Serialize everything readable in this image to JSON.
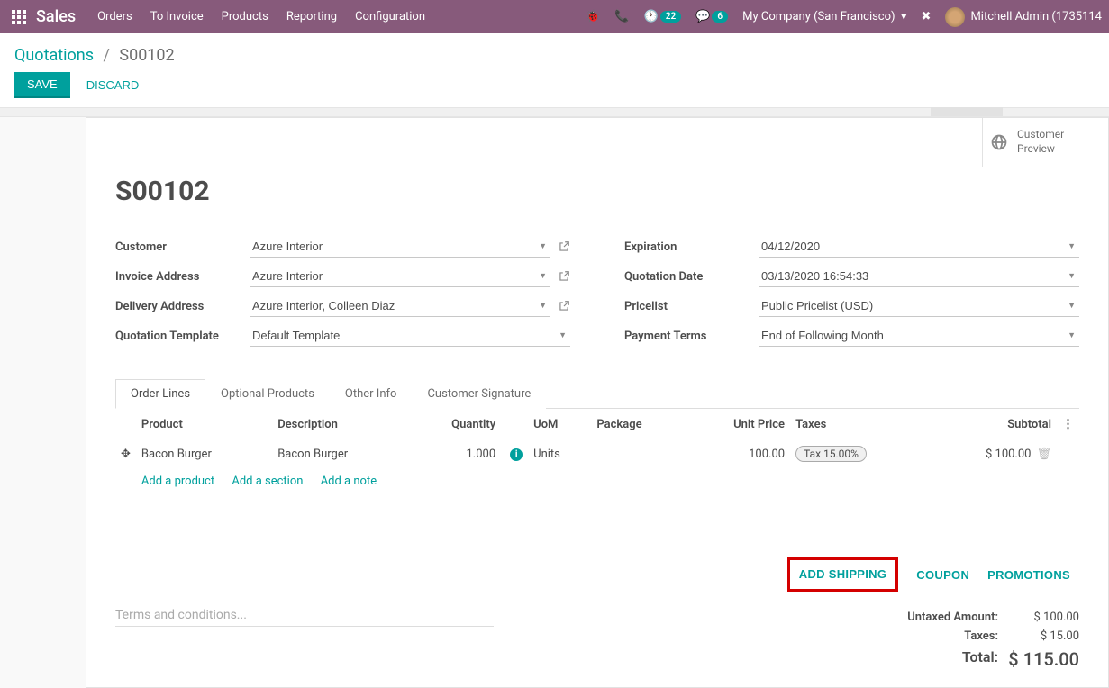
{
  "nav": {
    "brand": "Sales",
    "items": [
      "Orders",
      "To Invoice",
      "Products",
      "Reporting",
      "Configuration"
    ],
    "activity_count": "22",
    "msg_count": "6",
    "company": "My Company (San Francisco)",
    "user": "Mitchell Admin (1735114"
  },
  "breadcrumb": {
    "root": "Quotations",
    "current": "S00102"
  },
  "actions": {
    "save": "SAVE",
    "discard": "DISCARD"
  },
  "button_box": {
    "line1": "Customer",
    "line2": "Preview"
  },
  "record": {
    "name": "S00102"
  },
  "fields": {
    "customer_label": "Customer",
    "customer": "Azure Interior",
    "invoice_addr_label": "Invoice Address",
    "invoice_addr": "Azure Interior",
    "delivery_addr_label": "Delivery Address",
    "delivery_addr": "Azure Interior, Colleen Diaz",
    "quot_tmpl_label": "Quotation Template",
    "quot_tmpl": "Default Template",
    "expiration_label": "Expiration",
    "expiration": "04/12/2020",
    "quot_date_label": "Quotation Date",
    "quot_date": "03/13/2020 16:54:33",
    "pricelist_label": "Pricelist",
    "pricelist": "Public Pricelist (USD)",
    "payment_terms_label": "Payment Terms",
    "payment_terms": "End of Following Month"
  },
  "tabs": [
    "Order Lines",
    "Optional Products",
    "Other Info",
    "Customer Signature"
  ],
  "table": {
    "headers": {
      "product": "Product",
      "description": "Description",
      "quantity": "Quantity",
      "uom": "UoM",
      "package": "Package",
      "unit_price": "Unit Price",
      "taxes": "Taxes",
      "subtotal": "Subtotal"
    },
    "row": {
      "product": "Bacon Burger",
      "description": "Bacon Burger",
      "quantity": "1.000",
      "uom": "Units",
      "package": "",
      "unit_price": "100.00",
      "tax": "Tax 15.00%",
      "subtotal": "$ 100.00"
    },
    "add": {
      "product": "Add a product",
      "section": "Add a section",
      "note": "Add a note"
    }
  },
  "footer_btns": {
    "shipping": "ADD SHIPPING",
    "coupon": "COUPON",
    "promotions": "PROMOTIONS"
  },
  "terms_placeholder": "Terms and conditions...",
  "totals": {
    "untaxed_label": "Untaxed Amount:",
    "untaxed": "$ 100.00",
    "taxes_label": "Taxes:",
    "taxes": "$ 15.00",
    "total_label": "Total:",
    "total": "$ 115.00"
  }
}
